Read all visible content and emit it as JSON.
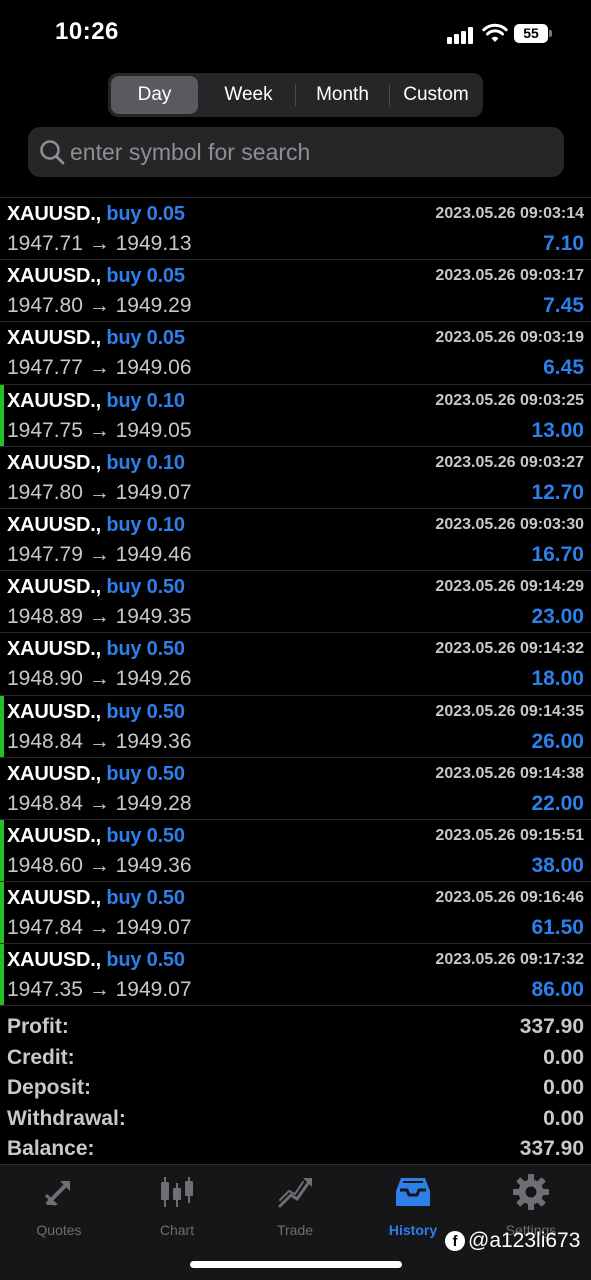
{
  "status_bar": {
    "time": "10:26",
    "battery": "55"
  },
  "period_tabs": [
    {
      "label": "Day",
      "active": true
    },
    {
      "label": "Week",
      "active": false
    },
    {
      "label": "Month",
      "active": false
    },
    {
      "label": "Custom",
      "active": false
    }
  ],
  "search": {
    "placeholder": "enter symbol for search"
  },
  "deals": [
    {
      "symbol": "XAUUSD.,",
      "side": "buy 0.05",
      "open": "1947.71",
      "close": "1949.13",
      "time": "2023.05.26 09:03:14",
      "profit": "7.10",
      "marked": false
    },
    {
      "symbol": "XAUUSD.,",
      "side": "buy 0.05",
      "open": "1947.80",
      "close": "1949.29",
      "time": "2023.05.26 09:03:17",
      "profit": "7.45",
      "marked": false
    },
    {
      "symbol": "XAUUSD.,",
      "side": "buy 0.05",
      "open": "1947.77",
      "close": "1949.06",
      "time": "2023.05.26 09:03:19",
      "profit": "6.45",
      "marked": false
    },
    {
      "symbol": "XAUUSD.,",
      "side": "buy 0.10",
      "open": "1947.75",
      "close": "1949.05",
      "time": "2023.05.26 09:03:25",
      "profit": "13.00",
      "marked": true
    },
    {
      "symbol": "XAUUSD.,",
      "side": "buy 0.10",
      "open": "1947.80",
      "close": "1949.07",
      "time": "2023.05.26 09:03:27",
      "profit": "12.70",
      "marked": false
    },
    {
      "symbol": "XAUUSD.,",
      "side": "buy 0.10",
      "open": "1947.79",
      "close": "1949.46",
      "time": "2023.05.26 09:03:30",
      "profit": "16.70",
      "marked": false
    },
    {
      "symbol": "XAUUSD.,",
      "side": "buy 0.50",
      "open": "1948.89",
      "close": "1949.35",
      "time": "2023.05.26 09:14:29",
      "profit": "23.00",
      "marked": false
    },
    {
      "symbol": "XAUUSD.,",
      "side": "buy 0.50",
      "open": "1948.90",
      "close": "1949.26",
      "time": "2023.05.26 09:14:32",
      "profit": "18.00",
      "marked": false
    },
    {
      "symbol": "XAUUSD.,",
      "side": "buy 0.50",
      "open": "1948.84",
      "close": "1949.36",
      "time": "2023.05.26 09:14:35",
      "profit": "26.00",
      "marked": true
    },
    {
      "symbol": "XAUUSD.,",
      "side": "buy 0.50",
      "open": "1948.84",
      "close": "1949.28",
      "time": "2023.05.26 09:14:38",
      "profit": "22.00",
      "marked": false
    },
    {
      "symbol": "XAUUSD.,",
      "side": "buy 0.50",
      "open": "1948.60",
      "close": "1949.36",
      "time": "2023.05.26 09:15:51",
      "profit": "38.00",
      "marked": true
    },
    {
      "symbol": "XAUUSD.,",
      "side": "buy 0.50",
      "open": "1947.84",
      "close": "1949.07",
      "time": "2023.05.26 09:16:46",
      "profit": "61.50",
      "marked": true
    },
    {
      "symbol": "XAUUSD.,",
      "side": "buy 0.50",
      "open": "1947.35",
      "close": "1949.07",
      "time": "2023.05.26 09:17:32",
      "profit": "86.00",
      "marked": true
    }
  ],
  "arrow": "→",
  "summary": [
    {
      "label": "Profit:",
      "value": "337.90"
    },
    {
      "label": "Credit:",
      "value": "0.00"
    },
    {
      "label": "Deposit:",
      "value": "0.00"
    },
    {
      "label": "Withdrawal:",
      "value": "0.00"
    },
    {
      "label": "Balance:",
      "value": "337.90"
    }
  ],
  "tabs": [
    {
      "label": "Quotes",
      "icon": "quotes-icon",
      "active": false
    },
    {
      "label": "Chart",
      "icon": "chart-icon",
      "active": false
    },
    {
      "label": "Trade",
      "icon": "trade-icon",
      "active": false
    },
    {
      "label": "History",
      "icon": "history-icon",
      "active": true
    },
    {
      "label": "Settings",
      "icon": "gear-icon",
      "active": false
    }
  ],
  "watermark": {
    "handle": "@a123li673",
    "icon": "facebook-icon"
  },
  "colors": {
    "accent_blue": "#2d7fe9",
    "profit_marker": "#25c12b",
    "background": "#000000"
  }
}
